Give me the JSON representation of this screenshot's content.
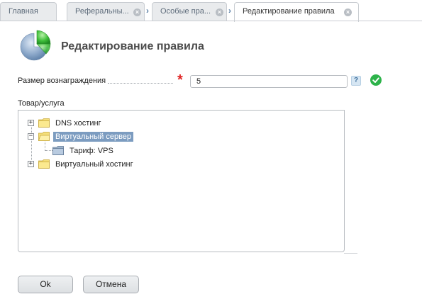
{
  "tabs": [
    {
      "label": "Главная",
      "closable": false,
      "active": false
    },
    {
      "label": "Реферальны...",
      "closable": true,
      "active": false
    },
    {
      "label": "Особые пра...",
      "closable": true,
      "active": false
    },
    {
      "label": "Редактирование правила",
      "closable": true,
      "active": true
    }
  ],
  "header": {
    "title": "Редактирование правила",
    "icon": "pie-chart-icon"
  },
  "form": {
    "reward_label": "Размер вознаграждения",
    "reward_value": "5",
    "required_mark": "*",
    "help_label": "?",
    "tree_label": "Товар/услуга"
  },
  "tree": {
    "nodes": [
      {
        "label": "DNS хостинг",
        "expanded": false,
        "selected": false
      },
      {
        "label": "Виртуальный сервер",
        "expanded": true,
        "selected": true
      },
      {
        "label": "Тариф: VPS",
        "child": true,
        "selected": false
      },
      {
        "label": "Виртуальный хостинг",
        "expanded": false,
        "selected": false
      }
    ]
  },
  "buttons": {
    "ok": "Ok",
    "cancel": "Отмена"
  },
  "colors": {
    "accent": "#7c9cc0",
    "required": "#e02424",
    "valid": "#2db34a"
  }
}
